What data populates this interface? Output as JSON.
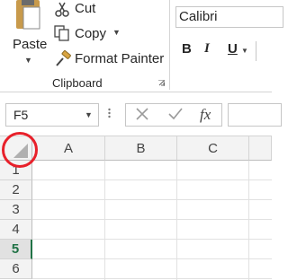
{
  "ribbon": {
    "clipboard": {
      "paste_label": "Paste",
      "cut_label": "Cut",
      "copy_label": "Copy",
      "format_painter_label": "Format Painter",
      "group_label": "Clipboard"
    },
    "font": {
      "font_name": "Calibri",
      "bold_label": "B",
      "italic_label": "I",
      "underline_label": "U"
    }
  },
  "formula_bar": {
    "name_box_value": "F5",
    "fx_label": "fx",
    "formula_value": ""
  },
  "grid": {
    "columns": [
      "A",
      "B",
      "C"
    ],
    "rows": [
      "1",
      "2",
      "3",
      "4",
      "5",
      "6"
    ],
    "active_row": "5"
  },
  "colors": {
    "accent": "#217346",
    "highlight_circle": "#e8202a"
  }
}
